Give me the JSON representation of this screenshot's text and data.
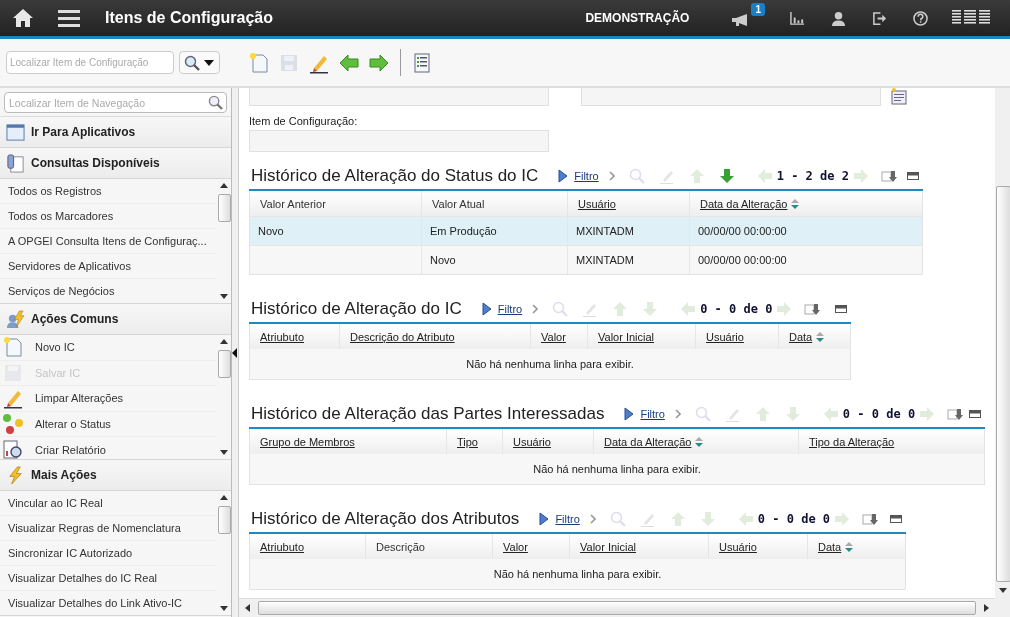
{
  "header": {
    "title": "Itens de Configuração",
    "environment": "DEMONSTRAÇÃO",
    "notification_count": "1"
  },
  "toolbar": {
    "search_placeholder": "Localizar Item de Configuração",
    "buttons": [
      {
        "kind": "new",
        "disabled": false
      },
      {
        "kind": "save",
        "disabled": true
      },
      {
        "kind": "clear",
        "disabled": false
      },
      {
        "kind": "previous",
        "disabled": false
      },
      {
        "kind": "next",
        "disabled": false
      },
      {
        "kind": "list",
        "disabled": false
      }
    ]
  },
  "sidebar": {
    "search_placeholder": "Localizar Item de Navegação",
    "sections": [
      {
        "title": "Ir Para Aplicativos",
        "kind": "apps"
      },
      {
        "title": "Consultas Disponíveis",
        "kind": "queries",
        "items": [
          {
            "label": "Todos os Registros"
          },
          {
            "label": "Todos os Marcadores"
          },
          {
            "label": "A OPGEI Consulta Itens de Configuraç..."
          },
          {
            "label": "Servidores de Aplicativos"
          },
          {
            "label": "Serviços de Negócios"
          }
        ]
      },
      {
        "title": "Ações Comuns",
        "kind": "actions",
        "items": [
          {
            "label": "Novo IC",
            "kind": "new",
            "disabled": false
          },
          {
            "label": "Salvar IC",
            "kind": "save",
            "disabled": true
          },
          {
            "label": "Limpar Alterações",
            "kind": "clear",
            "disabled": false
          },
          {
            "label": "Alterar o Status",
            "kind": "status",
            "disabled": false
          },
          {
            "label": "Criar Relatório",
            "kind": "report",
            "disabled": false
          }
        ]
      },
      {
        "title": "Mais Ações",
        "kind": "more",
        "items": [
          {
            "label": "Vincular ao IC Real"
          },
          {
            "label": "Visualizar Regras de Nomenclatura"
          },
          {
            "label": "Sincronizar IC Autorizado"
          },
          {
            "label": "Visualizar Detalhes do IC Real"
          },
          {
            "label": "Visualizar Detalhes do Link Ativo-IC"
          }
        ]
      }
    ]
  },
  "form": {
    "label": "Item de Configuração:"
  },
  "tables": [
    {
      "title": "Histórico de Alteração do Status do IC",
      "filter": "Filtro",
      "pager": "1 - 2 de 2",
      "next_row_enabled": true,
      "columns": [
        {
          "label": "Valor Anterior",
          "link": false,
          "sort": false
        },
        {
          "label": "Valor Atual",
          "link": false,
          "sort": false
        },
        {
          "label": "Usuário",
          "link": true,
          "sort": false
        },
        {
          "label": "Data da Alteração",
          "link": true,
          "sort": true
        }
      ],
      "rows": [
        {
          "selected": true,
          "cells": [
            "Novo",
            "Em Produção",
            "MXINTADM",
            "00/00/00 00:00:00"
          ]
        },
        {
          "selected": false,
          "cells": [
            null,
            "Novo",
            "MXINTADM",
            "00/00/00 00:00:00"
          ]
        }
      ]
    },
    {
      "title": "Histórico de Alteração do IC",
      "filter": "Filtro",
      "pager": "0 - 0 de 0",
      "next_row_enabled": false,
      "columns": [
        {
          "label": "Atriubuto",
          "link": true,
          "sort": false
        },
        {
          "label": "Descrição do Atributo",
          "link": true,
          "sort": false
        },
        {
          "label": "Valor",
          "link": true,
          "sort": false
        },
        {
          "label": "Valor Inicial",
          "link": true,
          "sort": false
        },
        {
          "label": "Usuário",
          "link": true,
          "sort": false
        },
        {
          "label": "Data",
          "link": true,
          "sort": true
        }
      ],
      "empty_message": "Não há nenhuma linha para exibir."
    },
    {
      "title": "Histórico de Alteração das Partes Interessadas",
      "filter": "Filtro",
      "pager": "0 - 0 de 0",
      "next_row_enabled": false,
      "columns": [
        {
          "label": "Grupo de Membros",
          "link": true,
          "sort": false
        },
        {
          "label": "Tipo",
          "link": true,
          "sort": false
        },
        {
          "label": "Usuário",
          "link": true,
          "sort": false
        },
        {
          "label": "Data da Alteração",
          "link": true,
          "sort": true
        },
        {
          "label": "Tipo da Alteração",
          "link": true,
          "sort": false
        }
      ],
      "empty_message": "Não há nenhuma linha para exibir."
    },
    {
      "title": "Histórico de Alteração dos Atributos",
      "filter": "Filtro",
      "pager": "0 - 0 de 0",
      "next_row_enabled": false,
      "columns": [
        {
          "label": "Atriubuto",
          "link": true,
          "sort": false
        },
        {
          "label": "Descrição",
          "link": false,
          "sort": false
        },
        {
          "label": "Valor",
          "link": true,
          "sort": false
        },
        {
          "label": "Valor Inicial",
          "link": true,
          "sort": false
        },
        {
          "label": "Usuário",
          "link": true,
          "sort": false
        },
        {
          "label": "Data",
          "link": true,
          "sort": true
        }
      ],
      "empty_message": "Não há nenhuma linha para exibir."
    }
  ]
}
